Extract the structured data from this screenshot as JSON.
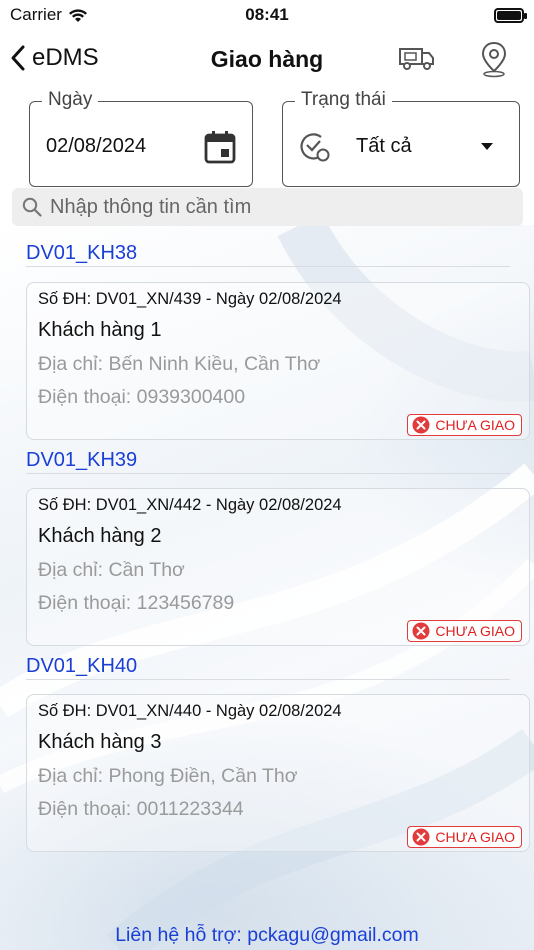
{
  "status_bar": {
    "carrier": "Carrier",
    "time": "08:41"
  },
  "nav": {
    "back_label": "eDMS",
    "title": "Giao hàng",
    "icons": [
      "delivery-truck-icon",
      "map-pin-icon"
    ]
  },
  "filters": {
    "date": {
      "label": "Ngày",
      "value": "02/08/2024"
    },
    "status": {
      "label": "Trạng thái",
      "value": "Tất cả"
    }
  },
  "search": {
    "placeholder": "Nhập thông tin cần tìm"
  },
  "groups": [
    {
      "header": "DV01_KH38",
      "order": {
        "number": "Số ĐH: DV01_XN/439  - Ngày 02/08/2024",
        "customer": "Khách hàng 1",
        "address": "Địa chỉ: Bến Ninh Kiều, Cần Thơ",
        "phone": "Điện thoại: 0939300400",
        "status": "CHƯA GIAO"
      }
    },
    {
      "header": "DV01_KH39",
      "order": {
        "number": "Số ĐH: DV01_XN/442  - Ngày 02/08/2024",
        "customer": "Khách hàng 2",
        "address": "Địa chỉ: Cần Thơ",
        "phone": "Điện thoại: 123456789",
        "status": "CHƯA GIAO"
      }
    },
    {
      "header": "DV01_KH40",
      "order": {
        "number": "Số ĐH: DV01_XN/440  - Ngày 02/08/2024",
        "customer": "Khách hàng 3",
        "address": "Địa chỉ: Phong Điền, Cần Thơ",
        "phone": "Điện thoại: 0011223344",
        "status": "CHƯA GIAO"
      }
    }
  ],
  "footer": {
    "text": "Liên hệ hỗ trợ: pckagu@gmail.com"
  },
  "colors": {
    "link_blue": "#1a3fd6",
    "status_red": "#e02020"
  }
}
